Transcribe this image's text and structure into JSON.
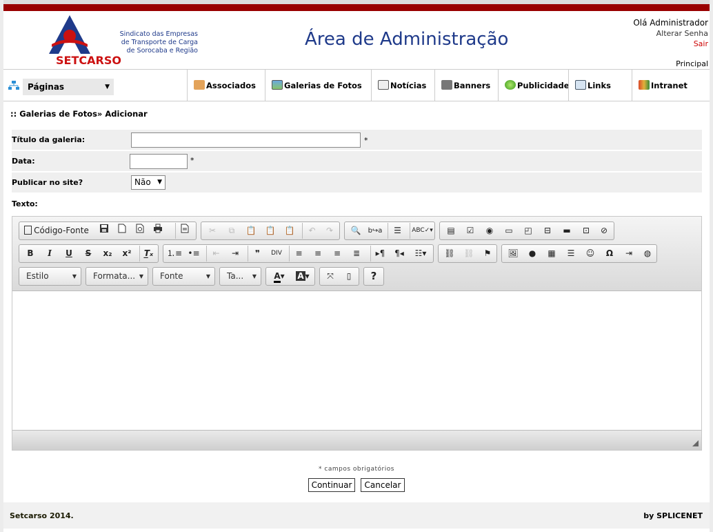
{
  "header": {
    "logo_name": "SETCARSO",
    "logo_sub": [
      "Sindicato das Empresas",
      "de Transporte de Carga",
      "de Sorocaba e Região"
    ],
    "title": "Área de Administração",
    "greeting": "Olá Administrador",
    "change_password": "Alterar Senha",
    "logout": "Sair",
    "home_link": "Principal"
  },
  "nav": {
    "pages_select": "Páginas",
    "items": [
      {
        "label": "Associados",
        "icon": "handshake-icon"
      },
      {
        "label": "Galerias de Fotos",
        "icon": "photo-gallery-icon"
      },
      {
        "label": "Notícias",
        "icon": "news-icon"
      },
      {
        "label": "Banners",
        "icon": "banner-icon"
      },
      {
        "label": "Publicidade",
        "icon": "green-globe-icon"
      },
      {
        "label": "Links",
        "icon": "links-icon"
      },
      {
        "label": "Intranet",
        "icon": "people-icon"
      }
    ]
  },
  "breadcrumb": ":: Galerias de Fotos» Adicionar",
  "form": {
    "title_label": "Título da galeria:",
    "title_value": "",
    "date_label": "Data:",
    "date_value": "",
    "publish_label": "Publicar no site?",
    "publish_value": "Não",
    "text_label": "Texto:",
    "required_mark": "*"
  },
  "editor": {
    "source_label": "Código-Fonte",
    "combos": [
      "Estilo",
      "Formata...",
      "Fonte",
      "Ta..."
    ],
    "help": "?"
  },
  "required_note": "* campos obrigatórios",
  "buttons": {
    "continue": "Continuar",
    "cancel": "Cancelar"
  },
  "footer": {
    "left": "Setcarso 2014.",
    "right": "by SPLICENET"
  },
  "colors": {
    "brand_red": "#990000",
    "brand_blue": "#1f3a8a",
    "logo_red": "#cc1111"
  }
}
